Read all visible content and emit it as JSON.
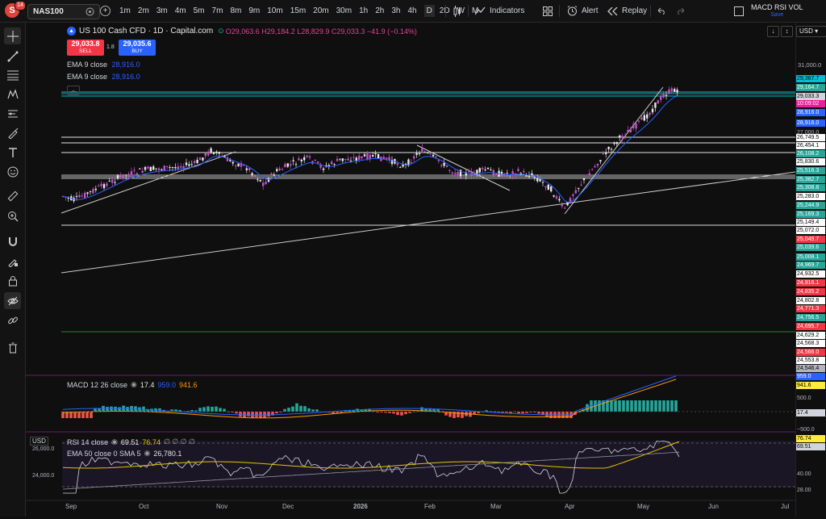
{
  "topbar": {
    "logo_letter": "S",
    "logo_badge": "14",
    "symbol": "NAS100",
    "intervals": [
      "1m",
      "2m",
      "3m",
      "4m",
      "5m",
      "7m",
      "8m",
      "9m",
      "10m",
      "15m",
      "20m",
      "30m",
      "1h",
      "2h",
      "3h",
      "4h",
      "D",
      "2D",
      "W",
      "M"
    ],
    "active_interval": "D",
    "indicators_label": "Indicators",
    "alert_label": "Alert",
    "replay_label": "Replay",
    "layout_name": "MACD RSI VOL",
    "layout_sub": "Save"
  },
  "legend": {
    "title": "US 100 Cash CFD · 1D · Capital.com",
    "ohlc": "O29,063.6 H29,184.2 L28,829.9 C29,033.3 −41.9 (−0.14%)",
    "sell_price": "29,033.8",
    "sell_label": "SELL",
    "spread": "1.8",
    "buy_price": "29,035.6",
    "buy_label": "BUY",
    "ema1_label": "EMA 9 close",
    "ema1_value": "28,916.0",
    "ema2_label": "EMA 9 close",
    "ema2_value": "28,916.0",
    "macd_label": "MACD 12 26 close",
    "macd_v1": "17.4",
    "macd_v2": "959.0",
    "macd_v3": "941.6",
    "rsi_label": "RSI 14 close",
    "rsi_v1": "69.51",
    "rsi_v2": "76.74",
    "rsi_rest": "∅ ∅ ∅ ∅",
    "ema50_label": "EMA 50 close 0 SMA 5",
    "ema50_value": "26,780.1",
    "currency": "USD",
    "left_currency": "USD"
  },
  "price_axis": {
    "top_tick": "31,000.0",
    "labels": [
      {
        "text": "29,367.7",
        "bg": "#00bcd4",
        "fg": "#000"
      },
      {
        "text": "29,164.7",
        "bg": "#26a69a",
        "fg": "#fff"
      },
      {
        "text": "29,033.3",
        "bg": "#d1d4dc",
        "fg": "#000"
      },
      {
        "text": "10:09:02",
        "bg": "#e91e9c",
        "fg": "#fff"
      },
      {
        "text": "28,916.0",
        "bg": "#2962ff",
        "fg": "#fff"
      },
      {
        "text": "28,916.0",
        "bg": "#2962ff",
        "fg": "#fff"
      },
      {
        "text": "27,000.0",
        "bg": "",
        "fg": "#b2b5be"
      },
      {
        "text": "26,749.5",
        "bg": "#ffffff",
        "fg": "#000"
      },
      {
        "text": "26,454.1",
        "bg": "#ffffff",
        "fg": "#000"
      },
      {
        "text": "26,108.2",
        "bg": "#26a69a",
        "fg": "#fff"
      },
      {
        "text": "25,830.6",
        "bg": "#ffffff",
        "fg": "#000"
      },
      {
        "text": "25,516.3",
        "bg": "#26a69a",
        "fg": "#fff"
      },
      {
        "text": "25,382.7",
        "bg": "#26a69a",
        "fg": "#fff"
      },
      {
        "text": "25,308.8",
        "bg": "#26a69a",
        "fg": "#fff"
      },
      {
        "text": "25,283.0",
        "bg": "#ffffff",
        "fg": "#000"
      },
      {
        "text": "25,244.9",
        "bg": "#26a69a",
        "fg": "#fff"
      },
      {
        "text": "25,169.3",
        "bg": "#26a69a",
        "fg": "#fff"
      },
      {
        "text": "25,149.4",
        "bg": "#ffffff",
        "fg": "#000"
      },
      {
        "text": "25,072.0",
        "bg": "#ffffff",
        "fg": "#000"
      },
      {
        "text": "25,049.7",
        "bg": "#f23645",
        "fg": "#fff"
      },
      {
        "text": "25,039.6",
        "bg": "#26a69a",
        "fg": "#fff"
      },
      {
        "text": "25,008.1",
        "bg": "#26a69a",
        "fg": "#fff"
      },
      {
        "text": "24,969.7",
        "bg": "#26a69a",
        "fg": "#fff"
      },
      {
        "text": "24,932.5",
        "bg": "#ffffff",
        "fg": "#000"
      },
      {
        "text": "24,916.1",
        "bg": "#f23645",
        "fg": "#fff"
      },
      {
        "text": "24,835.2",
        "bg": "#f23645",
        "fg": "#fff"
      },
      {
        "text": "24,802.8",
        "bg": "#ffffff",
        "fg": "#000"
      },
      {
        "text": "24,771.3",
        "bg": "#f23645",
        "fg": "#fff"
      },
      {
        "text": "24,756.5",
        "bg": "#26a69a",
        "fg": "#fff"
      },
      {
        "text": "24,695.7",
        "bg": "#f23645",
        "fg": "#fff"
      },
      {
        "text": "24,629.2",
        "bg": "#ffffff",
        "fg": "#000"
      },
      {
        "text": "24,568.3",
        "bg": "#ffffff",
        "fg": "#000"
      },
      {
        "text": "24,566.0",
        "bg": "#f23645",
        "fg": "#fff"
      },
      {
        "text": "24,553.8",
        "bg": "#ffffff",
        "fg": "#000"
      },
      {
        "text": "24,546.4",
        "bg": "#b2b5be",
        "fg": "#000"
      }
    ],
    "macd_ticks": [
      "959.0",
      "941.6",
      "500.0",
      "17.4",
      "−500.0"
    ],
    "rsi_ticks": [
      "76.74",
      "69.51",
      "40.00",
      "28.00"
    ],
    "rsi_left_ticks": [
      "26,000.0",
      "24,000.0"
    ]
  },
  "time_axis": [
    "Sep",
    "Oct",
    "Nov",
    "Dec",
    "2026",
    "Feb",
    "Mar",
    "Apr",
    "May",
    "Jun",
    "Jul"
  ]
}
